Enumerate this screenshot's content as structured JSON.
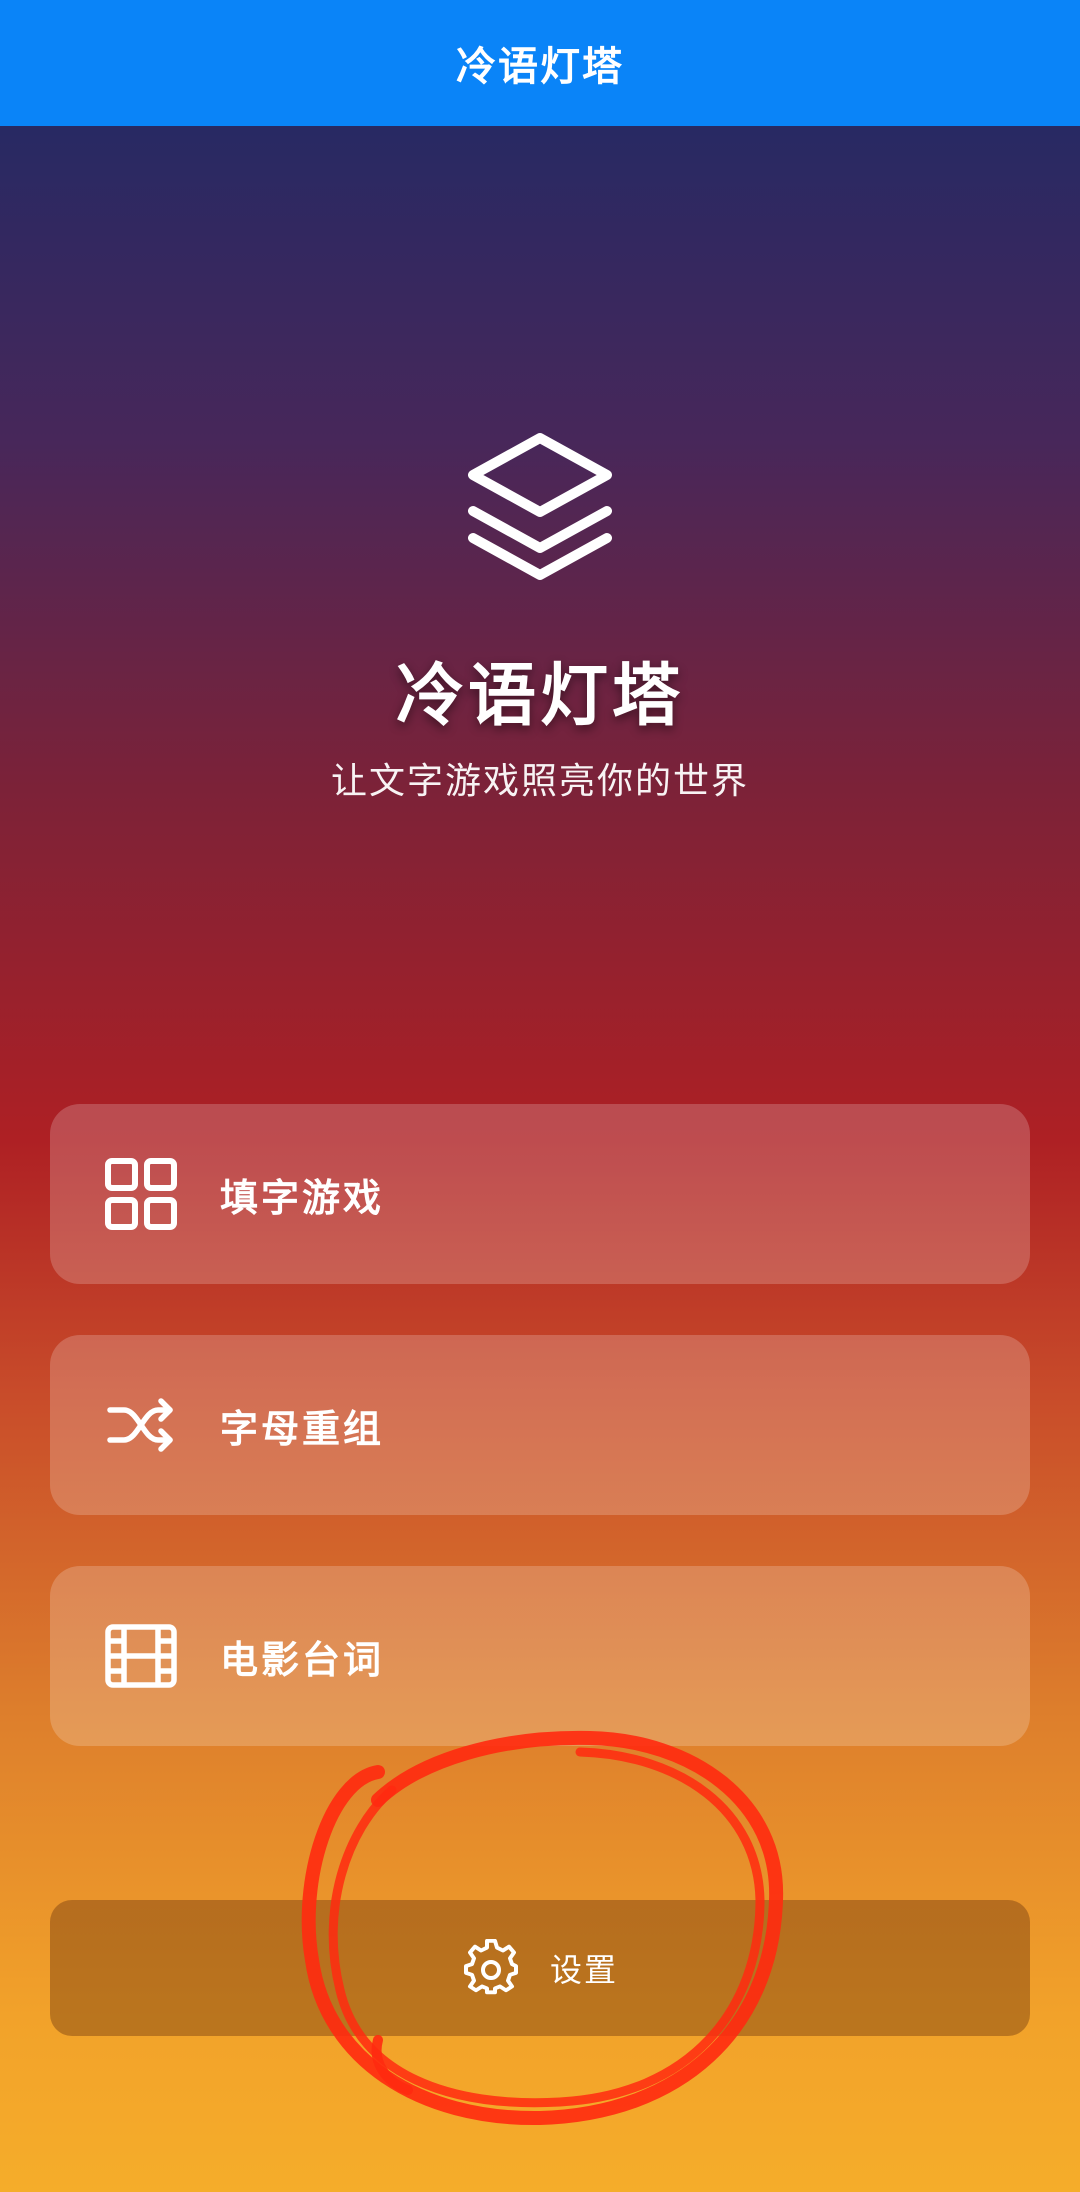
{
  "header": {
    "title": "冷语灯塔"
  },
  "hero": {
    "icon": "layers-icon",
    "title": "冷语灯塔",
    "subtitle": "让文字游戏照亮你的世界"
  },
  "menu": [
    {
      "label": "填字游戏",
      "icon": "grid-icon"
    },
    {
      "label": "字母重组",
      "icon": "shuffle-icon"
    },
    {
      "label": "电影台词",
      "icon": "film-icon"
    }
  ],
  "settings": {
    "label": "设置",
    "icon": "gear-icon"
  },
  "colors": {
    "header_bg": "#0a84f8",
    "annotation": "#ff2a10"
  }
}
